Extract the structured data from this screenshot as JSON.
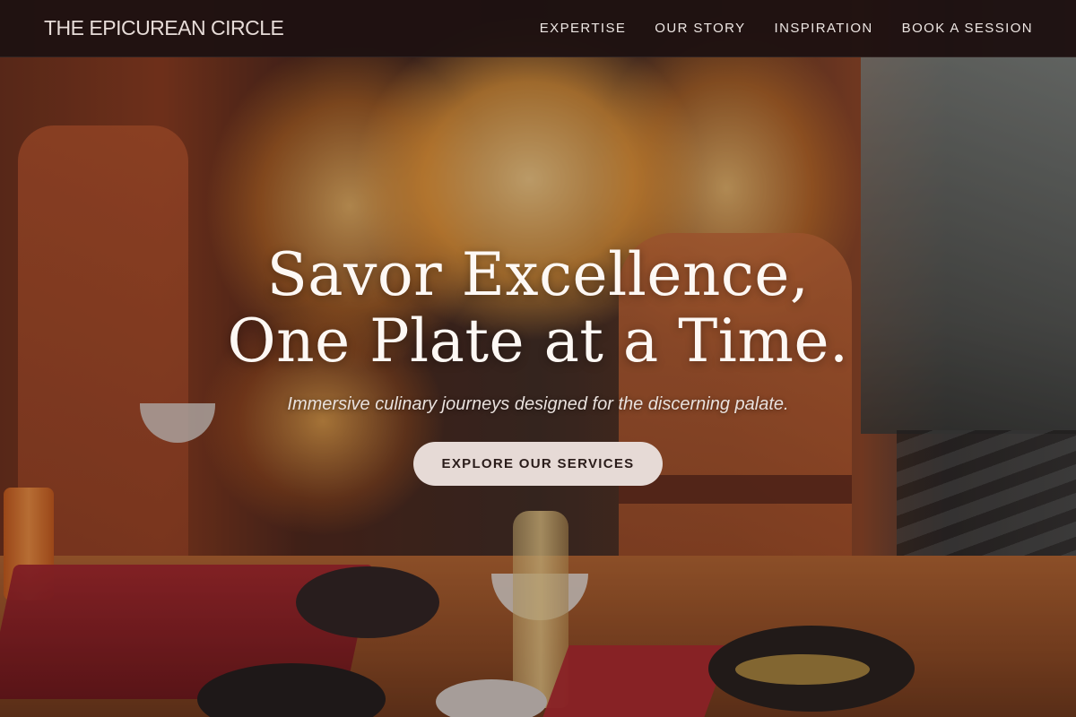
{
  "nav": {
    "logo": "THE EPICUREAN CIRCLE",
    "links": [
      "EXPERTISE",
      "OUR STORY",
      "INSPIRATION",
      "BOOK A SESSION"
    ]
  },
  "hero": {
    "title_line1": "Savor Excellence,",
    "title_line2": "One Plate at a Time.",
    "subtitle": "Immersive culinary journeys designed for the discerning palate.",
    "cta_label": "EXPLORE OUR SERVICES"
  },
  "colors": {
    "navbar_bg": "#1e1111",
    "cta_bg": "#e6dad6",
    "title_text": "#fdf8f4"
  }
}
